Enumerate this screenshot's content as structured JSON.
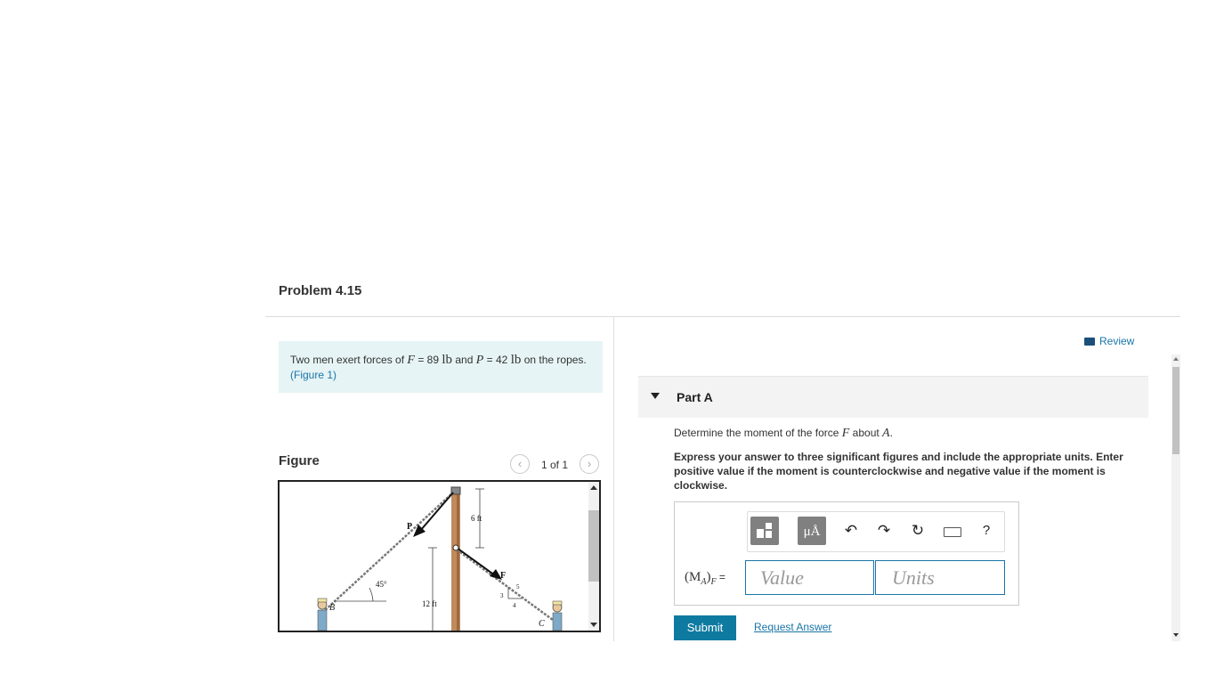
{
  "problem": {
    "title": "Problem 4.15"
  },
  "intro": {
    "text_1": "Two men exert forces of",
    "F_symbol": "F",
    "F_eq": "= 89",
    "F_unit": "lb",
    "and": "and",
    "P_symbol": "P",
    "P_eq": "= 42",
    "P_unit": "lb",
    "text_2": "on the ropes.",
    "figure_link": "(Figure 1)"
  },
  "figure": {
    "heading": "Figure",
    "pager": "1 of 1",
    "prev_icon": "chevron-left-icon",
    "next_icon": "chevron-right-icon",
    "labels": {
      "P": "P",
      "F": "F",
      "B": "B",
      "C": "C",
      "six_ft": "6 ft",
      "twelve_ft": "12 ft",
      "angle": "45°",
      "three": "3",
      "four": "4",
      "five": "5"
    }
  },
  "review": {
    "label": "Review",
    "icon": "book-icon"
  },
  "part": {
    "label": "Part A",
    "question_prefix": "Determine the moment of the force",
    "question_force": "F",
    "question_mid": "about",
    "question_point": "A",
    "question_end": ".",
    "instructions": "Express your answer to three significant figures and include the appropriate units. Enter positive value if the moment is counterclockwise and negative value if the moment is clockwise."
  },
  "answer": {
    "label": "(M",
    "label_sub": "A",
    "label_close": ")",
    "label_F": "F",
    "label_eq": " =",
    "value_placeholder": "Value",
    "units_placeholder": "Units",
    "units_button": "μÅ",
    "help": "?"
  },
  "actions": {
    "submit": "Submit",
    "request_answer": "Request Answer"
  },
  "colors": {
    "accent": "#0f7aa0",
    "link": "#1a75a8",
    "intro_bg": "#e6f4f5",
    "pole": "#c08a5c"
  }
}
